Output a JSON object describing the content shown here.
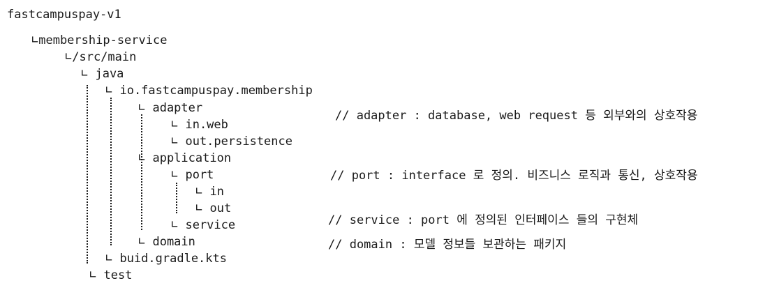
{
  "tree": {
    "root": "fastcampuspay-v1",
    "membership_service": "∟membership-service",
    "src_main": "∟/src/main",
    "java": "∟ java",
    "package": "∟ io.fastcampuspay.membership",
    "adapter": "∟ adapter",
    "in_web": "∟ in.web",
    "out_persistence": "∟ out.persistence",
    "application": "∟ application",
    "port": "∟ port",
    "port_in": "∟ in",
    "port_out": "∟ out",
    "service": "∟ service",
    "domain": "∟ domain",
    "build_gradle": "∟ buid.gradle.kts",
    "test": "∟ test"
  },
  "comments": {
    "adapter": "// adapter : database, web request 등 외부와의 상호작용",
    "port": "// port : interface 로 정의. 비즈니스 로직과 통신, 상호작용",
    "service": "// service : port 에 정의된 인터페이스 들의 구현체",
    "domain": "// domain : 모델 정보들 보관하는 패키지"
  }
}
